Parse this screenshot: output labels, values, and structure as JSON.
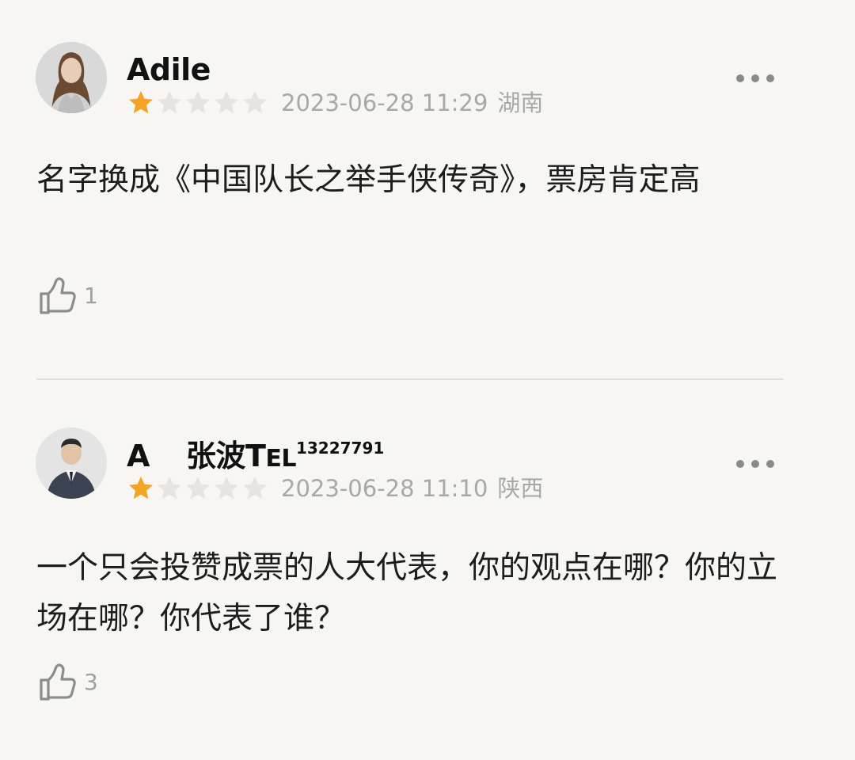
{
  "reviews": [
    {
      "username": "Adile",
      "rating": 1,
      "max_rating": 5,
      "date": "2023-06-28 11:29",
      "location": "湖南",
      "content": "名字换成《中国队长之举手侠传奇》，票房肯定高",
      "likes": "1"
    },
    {
      "username_part1": "A",
      "username_part2": "张波",
      "username_part3": "T",
      "username_part4": "EL",
      "username_part5": "13227791",
      "rating": 1,
      "max_rating": 5,
      "date": "2023-06-28 11:10",
      "location": "陕西",
      "content": "一个只会投赞成票的人大代表，你的观点在哪？你的立场在哪？你代表了谁？",
      "likes": "3"
    }
  ],
  "icons": {
    "star": "star-icon",
    "more": "more-dots-icon",
    "like": "thumbs-up-icon"
  },
  "colors": {
    "background": "#f7f6f2",
    "star_filled": "#f4a322",
    "star_empty": "#e6e4e0",
    "meta_text": "#a8a8a8"
  }
}
